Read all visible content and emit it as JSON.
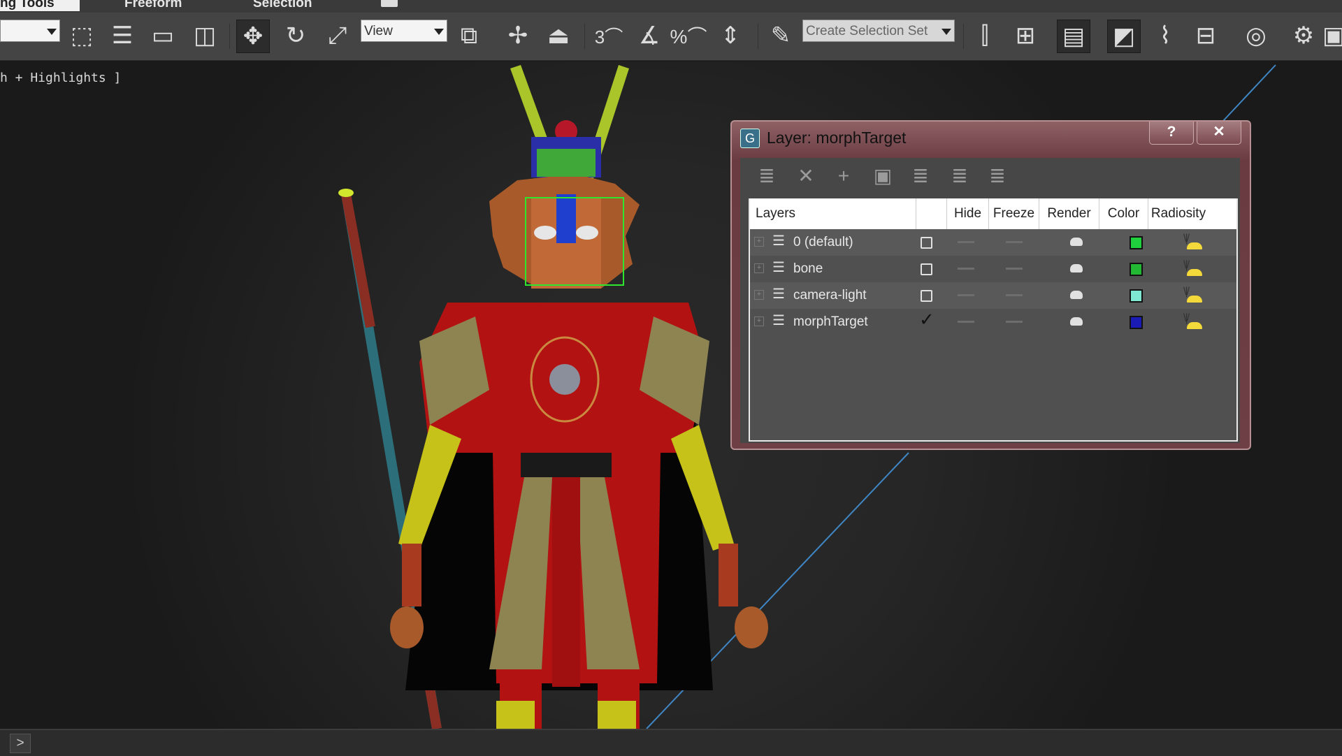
{
  "ribbon": {
    "tabs": [
      {
        "label": "ng Tools"
      },
      {
        "label": "Freeform"
      },
      {
        "label": "Selection"
      }
    ]
  },
  "toolbar": {
    "left_dropdown_value": "",
    "refcoord_value": "View",
    "selection_set_placeholder": "Create Selection Set"
  },
  "viewport": {
    "label": "h + Highlights ]"
  },
  "statusbar": {
    "play_glyph": ">"
  },
  "dialog": {
    "title": "Layer: morphTarget",
    "help_label": "?",
    "close_label": "✕",
    "icon_glyph": "G",
    "table": {
      "headers": [
        "Layers",
        "",
        "Hide",
        "Freeze",
        "Render",
        "Color",
        "Radiosity"
      ],
      "rows": [
        {
          "name": "0 (default)",
          "active": false,
          "color": "#1fd13c"
        },
        {
          "name": "bone",
          "active": false,
          "color": "#22b833"
        },
        {
          "name": "camera-light",
          "active": false,
          "color": "#7ee8d2"
        },
        {
          "name": "morphTarget",
          "active": true,
          "color": "#1a1ab5"
        }
      ]
    }
  },
  "colors": {
    "dialog_frame": "#6e3f45",
    "viewport_bg": "#262626",
    "toolbar_bg": "#444444",
    "helper_line": "#3f86c4"
  }
}
